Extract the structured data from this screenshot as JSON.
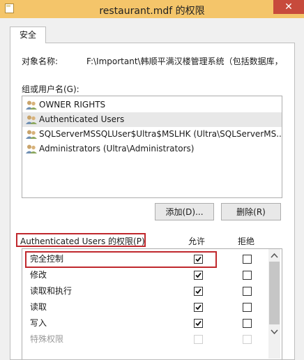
{
  "window": {
    "title": "restaurant.mdf 的权限",
    "close_glyph": "✕"
  },
  "tab": {
    "label": "安全"
  },
  "object": {
    "label": "对象名称:",
    "value": "F:\\Important\\韩顺平满汉楼管理系统（包括数据库，"
  },
  "groups": {
    "label": "组或用户名(G):",
    "items": [
      {
        "name": "OWNER RIGHTS"
      },
      {
        "name": "Authenticated Users",
        "selected": true
      },
      {
        "name": "SQLServerMSSQLUser$Ultra$MSLHK (Ultra\\SQLServerMS..."
      },
      {
        "name": "Administrators (Ultra\\Administrators)"
      }
    ]
  },
  "buttons": {
    "add": "添加(D)...",
    "remove": "删除(R)"
  },
  "permissions": {
    "label": "Authenticated Users 的权限(P)",
    "allow_header": "允许",
    "deny_header": "拒绝",
    "rows": [
      {
        "name": "完全控制",
        "allow": true,
        "deny": false
      },
      {
        "name": "修改",
        "allow": true,
        "deny": false
      },
      {
        "name": "读取和执行",
        "allow": true,
        "deny": false
      },
      {
        "name": "读取",
        "allow": true,
        "deny": false
      },
      {
        "name": "写入",
        "allow": true,
        "deny": false
      },
      {
        "name": "特殊权限",
        "allow": false,
        "deny": false
      }
    ]
  },
  "colors": {
    "titlebar": "#f4c56a",
    "close": "#c74a3c",
    "highlight": "#c0282d"
  },
  "icons": [
    "folder-icon",
    "close-icon",
    "users-icon",
    "checkbox",
    "scroll-up-icon",
    "scroll-down-icon"
  ]
}
